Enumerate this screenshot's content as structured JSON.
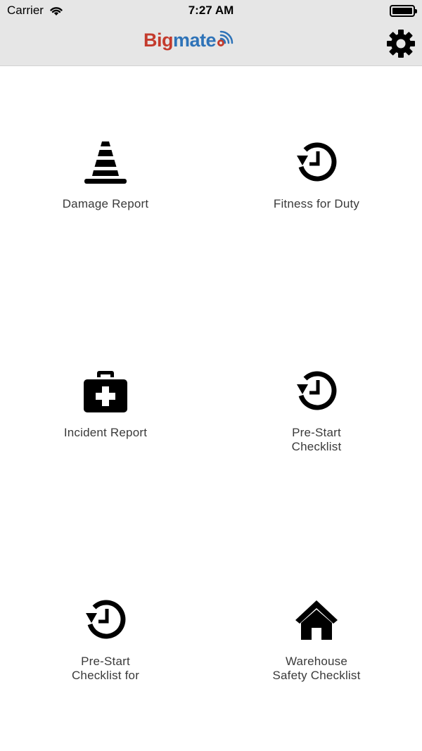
{
  "status_bar": {
    "carrier": "Carrier",
    "time": "7:27 AM"
  },
  "header": {
    "logo_part1": "Big",
    "logo_part2": "mate",
    "settings_icon": "gear-icon"
  },
  "tiles": [
    {
      "label": "Damage Report",
      "icon": "traffic-cone-icon"
    },
    {
      "label": "Fitness for Duty",
      "icon": "history-icon"
    },
    {
      "label": "Incident Report",
      "icon": "first-aid-kit-icon"
    },
    {
      "label": "Pre-Start\nChecklist",
      "icon": "history-icon"
    },
    {
      "label": "Pre-Start\nChecklist for",
      "icon": "history-icon"
    },
    {
      "label": "Warehouse\nSafety Checklist",
      "icon": "home-icon"
    }
  ],
  "colors": {
    "logo_red": "#c43b2d",
    "logo_blue": "#2e73b8",
    "navbar_bg": "#e6e6e6"
  }
}
